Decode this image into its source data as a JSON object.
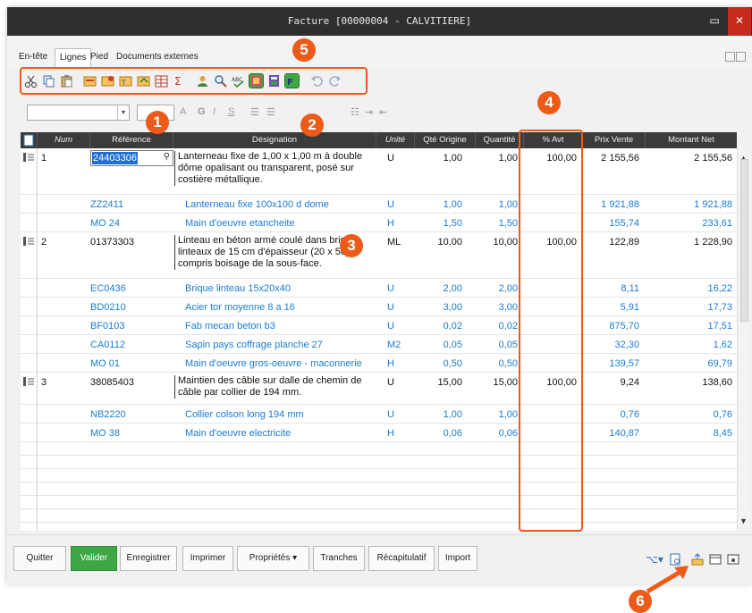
{
  "window": {
    "title": "Facture [00000004 - CALVITIERE]",
    "minimize_glyph": "▭",
    "close_glyph": "✕"
  },
  "tabs": [
    {
      "label": "En-tête",
      "active": false
    },
    {
      "label": "Lignes",
      "active": true
    },
    {
      "label": "Pied",
      "active": false
    },
    {
      "label": "Documents externes",
      "active": false
    }
  ],
  "format_bar": {
    "font_arrow": "▾",
    "color_a": "A",
    "bold": "G",
    "italic": "I",
    "underline": "S"
  },
  "columns": {
    "num": "Num",
    "reference": "Référence",
    "designation": "Désignation",
    "unite": "Unité",
    "qte_origine": "Qté Origine",
    "quantite": "Quantité",
    "pct_avt": "% Avt",
    "prix_vente": "Prix Vente",
    "montant_net": "Montant Net"
  },
  "rows": [
    {
      "num": "1",
      "ref": "24403306",
      "desc": "Lanterneau fixe de 1,00 x 1,00 m à double dôme opalisant ou transparent, posé sur costière métallique.",
      "unit": "U",
      "qte_origine": "1,00",
      "quantite": "1,00",
      "pct_avt": "100,00",
      "prix": "2 155,56",
      "montant": "2 155,56"
    },
    {
      "ref": "ZZ2411",
      "desc": "Lanterneau fixe 100x100 d dome",
      "unit": "U",
      "qte_origine": "1,00",
      "quantite": "1,00",
      "prix": "1 921,88",
      "montant": "1 921,88"
    },
    {
      "ref": "MO 24",
      "desc": "Main d'oeuvre etancheite",
      "unit": "H",
      "qte_origine": "1,50",
      "quantite": "1,50",
      "prix": "155,74",
      "montant": "233,61"
    },
    {
      "num": "2",
      "ref": "01373303",
      "desc": "Linteau en béton armé coulé dans briq linteaux de 15 cm d'épaisseur (20 x 50), compris boisage de la sous-face.",
      "unit": "ML",
      "qte_origine": "10,00",
      "quantite": "10,00",
      "pct_avt": "100,00",
      "prix": "122,89",
      "montant": "1 228,90"
    },
    {
      "ref": "EC0436",
      "desc": "Brique linteau 15x20x40",
      "unit": "U",
      "qte_origine": "2,00",
      "quantite": "2,00",
      "prix": "8,11",
      "montant": "16,22"
    },
    {
      "ref": "BD0210",
      "desc": "Acier tor moyenne 8 a 16",
      "unit": "U",
      "qte_origine": "3,00",
      "quantite": "3,00",
      "prix": "5,91",
      "montant": "17,73"
    },
    {
      "ref": "BF0103",
      "desc": "Fab mecan beton b3",
      "unit": "U",
      "qte_origine": "0,02",
      "quantite": "0,02",
      "prix": "875,70",
      "montant": "17,51"
    },
    {
      "ref": "CA0112",
      "desc": "Sapin pays coffrage planche 27",
      "unit": "M2",
      "qte_origine": "0,05",
      "quantite": "0,05",
      "prix": "32,30",
      "montant": "1,62"
    },
    {
      "ref": "MO 01",
      "desc": "Main d'oeuvre gros-oeuvre - maconnerie",
      "unit": "H",
      "qte_origine": "0,50",
      "quantite": "0,50",
      "prix": "139,57",
      "montant": "69,79"
    },
    {
      "num": "3",
      "ref": "38085403",
      "desc": "Maintien des câble sur dalle de chemin de câble par collier de 194 mm.",
      "unit": "U",
      "qte_origine": "15,00",
      "quantite": "15,00",
      "pct_avt": "100,00",
      "prix": "9,24",
      "montant": "138,60"
    },
    {
      "ref": "NB2220",
      "desc": "Collier colson long 194 mm",
      "unit": "U",
      "qte_origine": "1,00",
      "quantite": "1,00",
      "prix": "0,76",
      "montant": "0,76"
    },
    {
      "ref": "MO 38",
      "desc": "Main d'oeuvre electricite",
      "unit": "H",
      "qte_origine": "0,06",
      "quantite": "0,06",
      "prix": "140,87",
      "montant": "8,45"
    }
  ],
  "buttons": {
    "quitter": "Quitter",
    "valider": "Valider",
    "enregistrer": "Enregistrer",
    "imprimer": "Imprimer",
    "proprietes": "Propriétés",
    "proprietes_arrow": "▾",
    "tranches": "Tranches",
    "recapitulatif": "Récapitulatif",
    "import": "Import"
  },
  "callouts": {
    "c1": "1",
    "c2": "2",
    "c3": "3",
    "c4": "4",
    "c5": "5",
    "c6": "6"
  },
  "colors": {
    "accent": "#ee5a18",
    "sub_line_text": "#1b7bd1",
    "title_bar": "#2f2f2f",
    "grid_header": "#3b3b3b",
    "valider": "#3fa646"
  },
  "icons": [
    "scissors-icon",
    "copy-icon",
    "paste-icon",
    "insert-line-icon",
    "insert-chapter-icon",
    "insert-text-icon",
    "move-line-icon",
    "table-icon",
    "sum-icon",
    "user-icon",
    "search-icon",
    "spellcheck-icon",
    "grid-icon",
    "calculator-icon",
    "highlight-icon",
    "undo-icon",
    "redo-icon"
  ]
}
